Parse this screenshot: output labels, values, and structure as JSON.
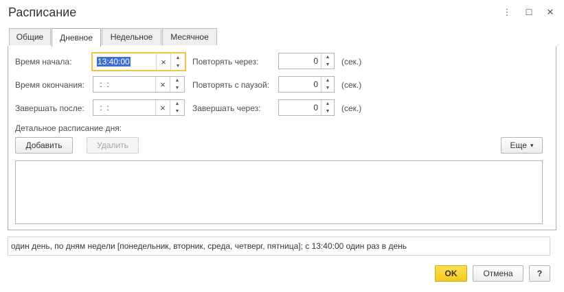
{
  "window": {
    "title": "Расписание",
    "menu_icon": "⋮",
    "maximize_icon": "☐",
    "close_icon": "✕"
  },
  "tabs": [
    {
      "label": "Общие"
    },
    {
      "label": "Дневное"
    },
    {
      "label": "Недельное"
    },
    {
      "label": "Месячное"
    }
  ],
  "active_tab": "Дневное",
  "fields": {
    "start_time": {
      "label": "Время начала:",
      "value": "13:40:00"
    },
    "end_time": {
      "label": "Время окончания:",
      "value": " :  :"
    },
    "finish_after": {
      "label": "Завершать после:",
      "value": " :  :"
    },
    "repeat_every": {
      "label": "Повторять через:",
      "value": "0",
      "unit": "(сек.)"
    },
    "repeat_pause": {
      "label": "Повторять с паузой:",
      "value": "0",
      "unit": "(сек.)"
    },
    "finish_in": {
      "label": "Завершать через:",
      "value": "0",
      "unit": "(сек.)"
    }
  },
  "detail": {
    "label": "Детальное расписание дня:",
    "add_label": "Добавить",
    "delete_label": "Удалить",
    "more_label": "Еще",
    "more_arrow": "▾"
  },
  "summary": "один день, по дням недели [понедельник, вторник, среда, четверг, пятница]; с 13:40:00 один раз в день",
  "footer": {
    "ok_label": "OK",
    "cancel_label": "Отмена",
    "help_label": "?"
  },
  "glyphs": {
    "clear": "×",
    "up": "▲",
    "down": "▼"
  },
  "colors": {
    "focus_border": "#f6c340",
    "ok_button": "#f4c91e",
    "selection": "#3b6ed6"
  }
}
